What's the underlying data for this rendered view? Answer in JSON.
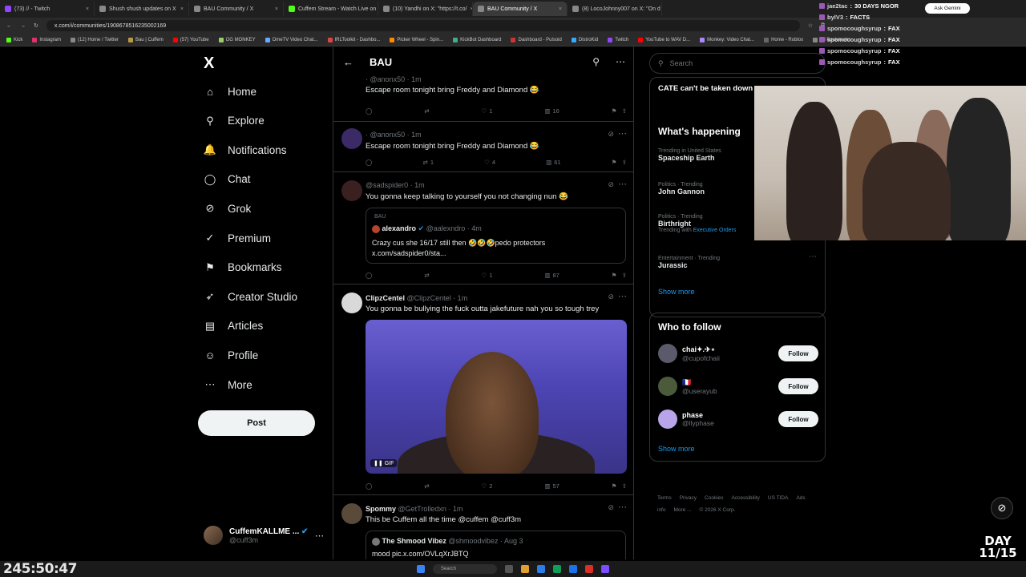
{
  "browser": {
    "tabs": [
      {
        "label": "(73) // - Twitch",
        "color": "#9146ff"
      },
      {
        "label": "Shush shush updates on X",
        "color": "#888"
      },
      {
        "label": "BAU Community / X",
        "color": "#888"
      },
      {
        "label": "Cuffem Stream - Watch Live on",
        "color": "#53fc18"
      },
      {
        "label": "(10) Yandhi on X: \"https://t.co/",
        "color": "#888"
      },
      {
        "label": "BAU Community / X",
        "color": "#888",
        "active": true
      },
      {
        "label": "(8) LocoJohnny007 on X: \"On d",
        "color": "#888"
      }
    ],
    "url": "x.com/i/communities/1908678516235002169",
    "ask_gemini": "Ask Gemini",
    "bookmarks": [
      "Kick",
      "Instagram",
      "(12) Home / Twitter",
      "Bau | Cuffem",
      "(57) YouTube",
      "OG MONKEY",
      "OmeTV Video Chat...",
      "IRLToolkit - Dashbo...",
      "Picker Wheel - Spin...",
      "KickBot Dashboard",
      "Dashboard - Pulsoid",
      "DistroKid",
      "Twitch",
      "YouTube to WAV D...",
      "Monkey: Video Chat...",
      "Home - Roblox",
      "All Bookmarks"
    ]
  },
  "sidebar": {
    "logo": "X",
    "items": [
      {
        "label": "Home",
        "icon": "⌂"
      },
      {
        "label": "Explore",
        "icon": "⚲"
      },
      {
        "label": "Notifications",
        "icon": "🔔"
      },
      {
        "label": "Chat",
        "icon": "◯"
      },
      {
        "label": "Grok",
        "icon": "⊘"
      },
      {
        "label": "Premium",
        "icon": "✓"
      },
      {
        "label": "Bookmarks",
        "icon": "⚑"
      },
      {
        "label": "Creator Studio",
        "icon": "➶"
      },
      {
        "label": "Articles",
        "icon": "▤"
      },
      {
        "label": "Profile",
        "icon": "☺"
      },
      {
        "label": "More",
        "icon": "⋯"
      }
    ],
    "post_label": "Post",
    "account": {
      "name": "CuffemKALLME ...",
      "handle": "@cuff3m"
    }
  },
  "main": {
    "title": "BAU",
    "posts": [
      {
        "handle": "· @anonx50 · 1m",
        "text": "Escape room tonight bring Freddy and Diamond 😂",
        "replies": "",
        "reposts": "",
        "likes": "1",
        "views": "16"
      },
      {
        "handle": "· @anonx50 · 1m",
        "text": "Escape room tonight bring Freddy and Diamond 😂",
        "replies": "",
        "reposts": "1",
        "likes": "4",
        "views": "61"
      },
      {
        "handle": "@sadspider0 · 1m",
        "text": "You gonna keep talking to yourself you not changing nun 😂",
        "replies": "",
        "reposts": "",
        "likes": "1",
        "views": "87",
        "quote": {
          "community": "BAU",
          "name": "alexandro",
          "handle": "@aalexndro · 4m",
          "text": "Crazy cus she 16/17 still then 🤣🤣🤣pedo protectors",
          "link": "x.com/sadspider0/sta..."
        }
      },
      {
        "name": "ClipzCentel",
        "handle": "@ClipzCentel · 1m",
        "text": "You gonna be bullying the fuck outta jakefuture nah you so tough trey",
        "replies": "",
        "reposts": "",
        "likes": "2",
        "views": "57",
        "gif_label": "GIF"
      },
      {
        "name": "Spommy",
        "handle": "@GetTrolledxn · 1m",
        "text": "This be Cuffem all the time @cuffem @cuff3m",
        "quote": {
          "name": "The Shmood Vibez",
          "handle": "@shmoodvibez · Aug 3",
          "text": "mood pic.x.com/OVLqXrJBTQ"
        }
      }
    ]
  },
  "right": {
    "search_placeholder": "Search",
    "top_trend": "CATE can't be taken down",
    "happening_title": "What's happening",
    "trends": [
      {
        "ctx": "Trending in United States",
        "name": "Spaceship Earth",
        "sub": ""
      },
      {
        "ctx": "Politics · Trending",
        "name": "John Gannon",
        "sub": ""
      },
      {
        "ctx": "Politics · Trending",
        "name": "Birthright",
        "sub": "Trending with",
        "sub_link": "Executive Orders"
      },
      {
        "ctx": "Entertainment · Trending",
        "name": "Jurassic",
        "sub": ""
      }
    ],
    "show_more": "Show more",
    "who_title": "Who to follow",
    "follow": [
      {
        "name": "chai✦.✈︎⋆",
        "handle": "@cupofchaii",
        "color": "#5a5a6a"
      },
      {
        "name": "🇫🇷",
        "handle": "@userayub",
        "color": "#4a5a3a"
      },
      {
        "name": "phase",
        "handle": "@llyphase",
        "color": "#b8a4e8"
      }
    ],
    "follow_label": "Follow",
    "footer": [
      "Terms",
      "Privacy",
      "Cookies",
      "Accessibility",
      "US TIDA",
      "Ads info",
      "More ...",
      "© 2026 X Corp."
    ]
  },
  "overlay": {
    "chat": [
      {
        "user": "jae2tac",
        "msg": "30 DAYS NGOR"
      },
      {
        "user": "bylV3",
        "msg": "FACTS"
      },
      {
        "user": "spomocoughsyrup",
        "msg": "FAX"
      },
      {
        "user": "spomocoughsyrup",
        "msg": "FAX"
      },
      {
        "user": "spomocoughsyrup",
        "msg": "FAX"
      },
      {
        "user": "spomocoughsyrup",
        "msg": "FAX"
      }
    ],
    "timer": "245:50:47",
    "day_badge": "DAY 11/15",
    "taskbar_search": "Search"
  }
}
